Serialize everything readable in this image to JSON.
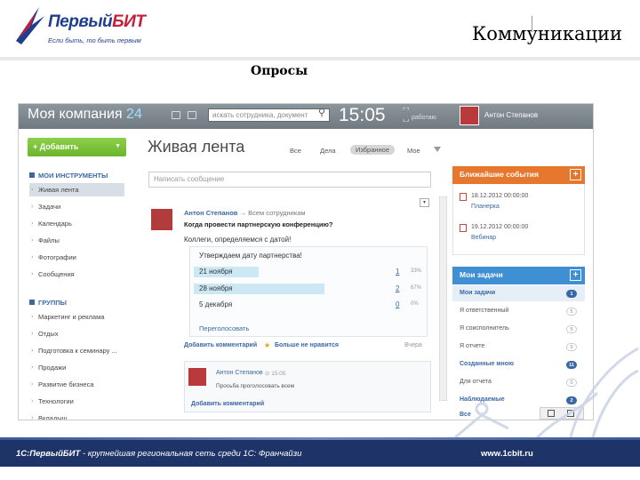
{
  "slide": {
    "brand_part1": "Первый",
    "brand_part2": "БИТ",
    "tagline": "Если быть, то быть первым",
    "title": "Коммуникации",
    "subtitle": "Опросы"
  },
  "colors": {
    "brand_blue": "#1e3f8e",
    "brand_red": "#c41e3a",
    "footer_bg": "#1e3367",
    "add_green": "#7cc23d",
    "events_orange": "#e8772e",
    "tasks_blue": "#3f8fd4",
    "link_blue": "#3a68a7"
  },
  "app": {
    "company": "Моя компания",
    "company_count": "24",
    "search_placeholder": "искать сотрудника, документ",
    "clock": "15:05",
    "status": "работаю",
    "user": "Антон Степанов",
    "icons": [
      "chat-icon",
      "mail-icon",
      "search-icon",
      "clock-icon",
      "avatar"
    ]
  },
  "sidebar": {
    "add_label": "Добавить",
    "tools_header": "Мои инструменты",
    "tools": [
      {
        "label": "Живая лента"
      },
      {
        "label": "Задачи"
      },
      {
        "label": "Календарь"
      },
      {
        "label": "Файлы"
      },
      {
        "label": "Фотографии"
      },
      {
        "label": "Сообщения"
      }
    ],
    "groups_header": "Группы",
    "groups": [
      {
        "label": "Маркетинг и реклама"
      },
      {
        "label": "Отдых"
      },
      {
        "label": "Подготовка к семинару ..."
      },
      {
        "label": "Продажи"
      },
      {
        "label": "Развитие бизнеса"
      },
      {
        "label": "Технологии"
      },
      {
        "label": "Вкладыш"
      }
    ]
  },
  "feed": {
    "title": "Живая лента",
    "tabs": [
      "Все",
      "Дела",
      "Избранное",
      "Мое"
    ],
    "message_placeholder": "Написать сообщение",
    "post": {
      "author": "Антон Степанов",
      "recipient": "→ Всем сотрудникам",
      "title": "Когда провести партнерскую конференцию?",
      "text": "Коллеги, определяемся с датой!",
      "poll": {
        "question": "Утверждаем дату партнерства!",
        "options": [
          {
            "label": "21 ноября",
            "votes": "1",
            "percent": "33%",
            "share": 0.33
          },
          {
            "label": "28 ноября",
            "votes": "2",
            "percent": "67%",
            "share": 0.67
          },
          {
            "label": "5 декабря",
            "votes": "0",
            "percent": "0%",
            "share": 0
          }
        ],
        "revote": "Переголосовать"
      },
      "add_comment": "Добавить комментарий",
      "like": "Больше не нравится",
      "time": "Вчера"
    },
    "comment": {
      "author": "Антон Степанов",
      "time": "⊙ 15:05",
      "text": "Просьба проголосовать всем",
      "add_comment": "Добавить комментарий"
    }
  },
  "events": {
    "title": "Ближайшие события",
    "items": [
      {
        "date": "18.12.2012 00:00:00",
        "name": "Планерка"
      },
      {
        "date": "19.12.2012 00:00:00",
        "name": "Вебинар"
      }
    ]
  },
  "tasks": {
    "title": "Мои задачи",
    "items": [
      {
        "label": "Мои задачи",
        "count": "1",
        "highlight": true
      },
      {
        "label": "Я ответственный",
        "count": "5",
        "highlight": false
      },
      {
        "label": "Я соисполнитель",
        "count": "5",
        "highlight": false
      },
      {
        "label": "Я отчете",
        "count": "0",
        "highlight": false
      },
      {
        "label": "Созданные мною",
        "count": "11",
        "highlight": true
      },
      {
        "label": "Для отчета",
        "count": "0",
        "highlight": false
      },
      {
        "label": "Наблюдаемые",
        "count": "2",
        "highlight": true
      },
      {
        "label": "Все",
        "count": "",
        "highlight": true
      }
    ]
  },
  "footer": {
    "brand": "1С:ПервыйБИТ",
    "text": " - крупнейшая региональная сеть среди 1С: Франчайзи",
    "url": "www.1cbit.ru"
  }
}
